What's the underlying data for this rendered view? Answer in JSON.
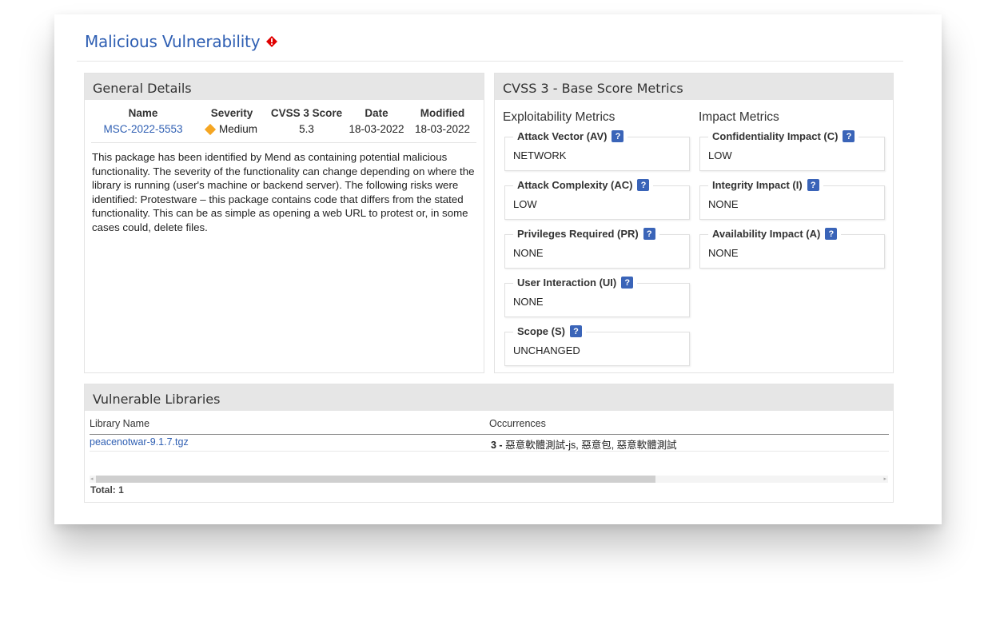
{
  "page": {
    "title": "Malicious Vulnerability",
    "accent": "#2f5fb3",
    "alert_color": "#e00000"
  },
  "general_details": {
    "heading": "General Details",
    "columns": {
      "name": "Name",
      "severity": "Severity",
      "cvss": "CVSS 3 Score",
      "date": "Date",
      "modified": "Modified"
    },
    "values": {
      "name": "MSC-2022-5553",
      "severity": "Medium",
      "cvss": "5.3",
      "date": "18-03-2022",
      "modified": "18-03-2022"
    },
    "description": "This package has been identified by Mend as containing potential malicious functionality. The severity of the functionality can change depending on where the library is running (user's machine or backend server). The following risks were identified: Protestware – this package contains code that differs from the stated functionality. This can be as simple as opening a web URL to protest or, in some cases could, delete files."
  },
  "cvss": {
    "heading": "CVSS 3 - Base Score Metrics",
    "exploitability_title": "Exploitability Metrics",
    "impact_title": "Impact Metrics",
    "help_glyph": "?",
    "exploitability": [
      {
        "label": "Attack Vector (AV)",
        "value": "NETWORK"
      },
      {
        "label": "Attack Complexity (AC)",
        "value": "LOW"
      },
      {
        "label": "Privileges Required (PR)",
        "value": "NONE"
      },
      {
        "label": "User Interaction (UI)",
        "value": "NONE"
      },
      {
        "label": "Scope (S)",
        "value": "UNCHANGED"
      }
    ],
    "impact": [
      {
        "label": "Confidentiality Impact (C)",
        "value": "LOW"
      },
      {
        "label": "Integrity Impact (I)",
        "value": "NONE"
      },
      {
        "label": "Availability Impact (A)",
        "value": "NONE"
      }
    ]
  },
  "vulnerable_libraries": {
    "heading": "Vulnerable Libraries",
    "columns": {
      "library": "Library Name",
      "occurrences": "Occurrences"
    },
    "rows": [
      {
        "library": "peacenotwar-9.1.7.tgz",
        "count": "3 - ",
        "occurrences": "惡意軟體測試-js, 惡意包, 惡意軟體測試"
      }
    ],
    "total": "Total: 1"
  }
}
